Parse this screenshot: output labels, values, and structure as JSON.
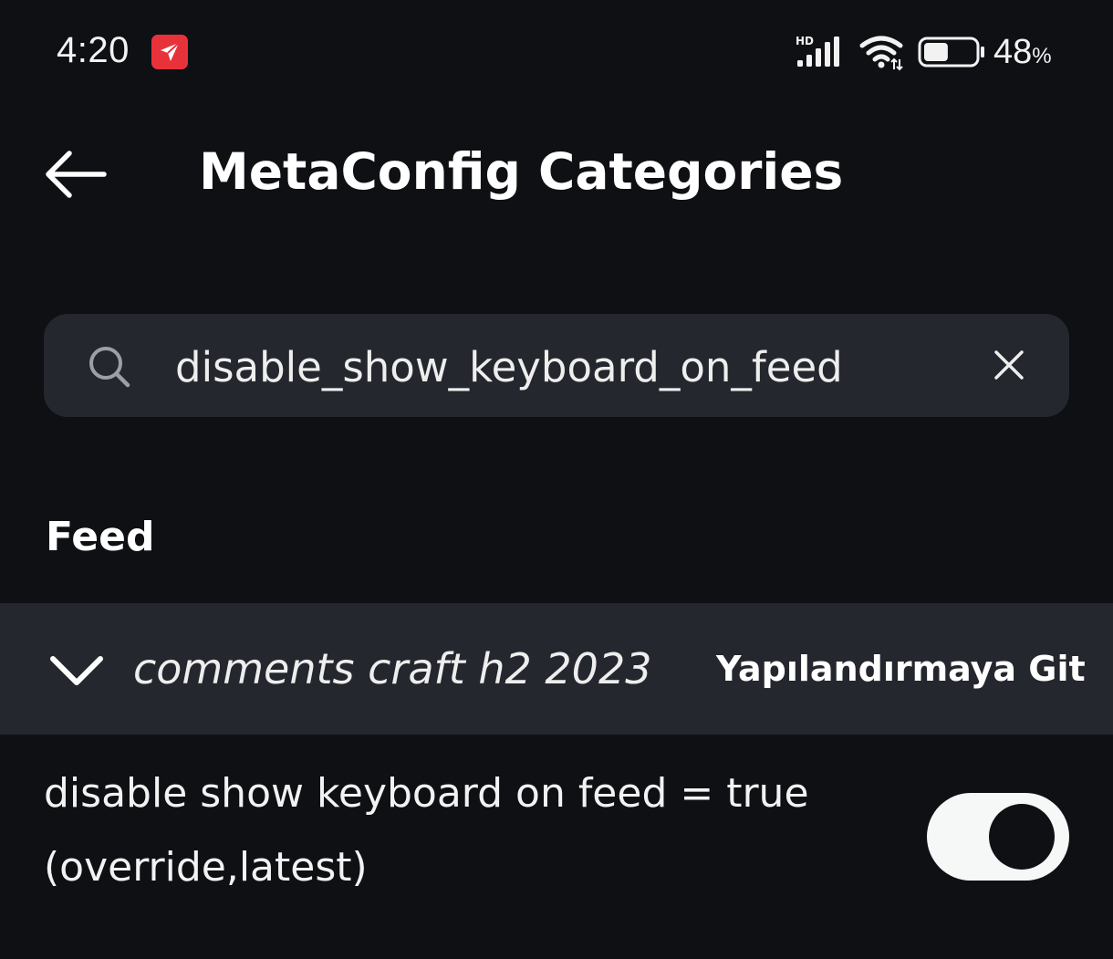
{
  "status_bar": {
    "time": "4:20",
    "network_label": "HD",
    "battery_percent": "48",
    "battery_percent_sign": "%",
    "battery_level": 0.48,
    "app_icon": "paper-plane-icon",
    "app_icon_color": "#e8323a"
  },
  "header": {
    "title": "MetaConfig Categories",
    "back_icon": "arrow-left-icon"
  },
  "search": {
    "value": "disable_show_keyboard_on_feed",
    "icon": "search-icon",
    "clear_icon": "close-icon"
  },
  "section": {
    "heading": "Feed"
  },
  "category": {
    "name": "comments craft h2 2023",
    "link_label": "Yapılandırmaya Git",
    "expanded": true,
    "icon": "chevron-down-icon"
  },
  "config_item": {
    "line1": "disable show keyboard on feed = true",
    "line2": "(override,latest)",
    "enabled": true
  },
  "colors": {
    "background": "#0e1014",
    "surface": "#24272d",
    "text": "#ffffff",
    "toggle_on": "#f6f7f7"
  }
}
